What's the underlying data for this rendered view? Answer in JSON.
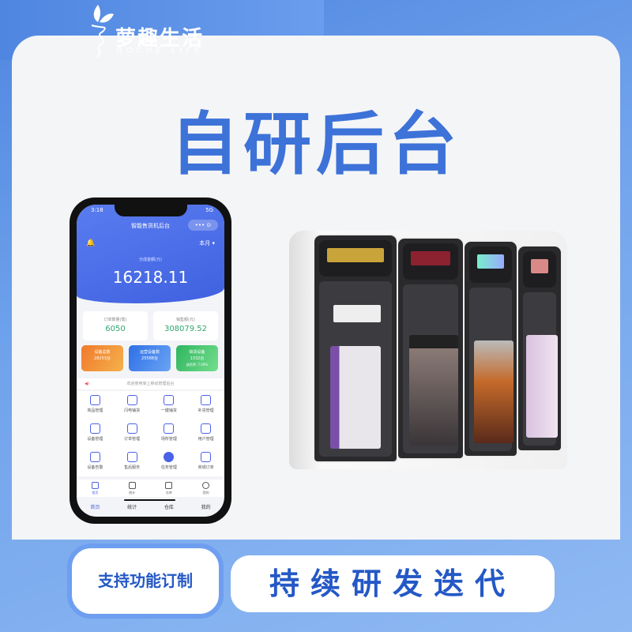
{
  "brand": {
    "name_cn": "萝趣生活",
    "name_en": "ROCHE LIFE"
  },
  "headline": "自研后台",
  "phone": {
    "time": "3:18",
    "signal": "5G",
    "app_title": "智能售货机后台",
    "capsule": "••• ⊙",
    "period": "本月 ▾",
    "share_label": "分成金额(元)",
    "share_value": "16218.11",
    "stats": [
      {
        "label": "订单数量(笔)",
        "value": "6050"
      },
      {
        "label": "销售额(元)",
        "value": "308079.52"
      }
    ],
    "cards": [
      {
        "label": "设备总数",
        "value": "28253台",
        "color": "#f08a3a"
      },
      {
        "label": "运营设备数",
        "value": "25588台",
        "color": "#3b7fe8"
      },
      {
        "label": "缺货设备",
        "value": "1332台",
        "extra": "缺货率: 7.00%",
        "color": "#3fbf6c"
      }
    ],
    "notice": "欢迎使用掌上移动管理后台",
    "menu": [
      "商品管理",
      "闪电铺货",
      "一键铺货",
      "补货管理",
      "设备管理",
      "订单管理",
      "场所管理",
      "用户管理",
      "设备告警",
      "售后服务",
      "任务管理",
      "商城订单"
    ],
    "tabbar": [
      "首页",
      "统计",
      "仓库",
      "我的"
    ],
    "bottom_tabs": [
      "首页",
      "统计",
      "仓库",
      "我的"
    ]
  },
  "features": {
    "left": "支持功能订制",
    "right": "持续研发迭代"
  },
  "colors": {
    "accent": "#3d72d8",
    "dark_blue": "#2458c6"
  }
}
